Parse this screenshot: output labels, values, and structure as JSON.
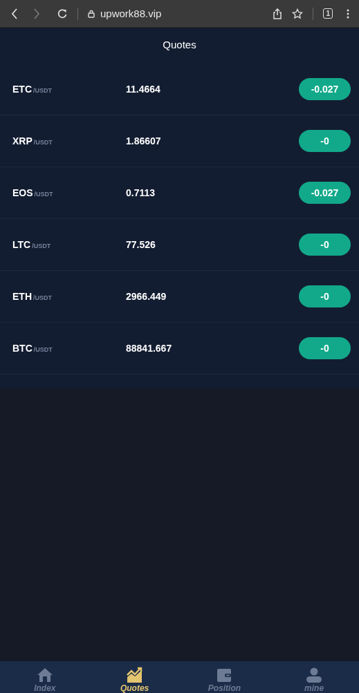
{
  "browser": {
    "url": "upwork88.vip",
    "tab_count": "1"
  },
  "header": {
    "title": "Quotes"
  },
  "quotes": [
    {
      "symbol": "ETC",
      "pair": "/USDT",
      "price": "11.4664",
      "change": "-0.027"
    },
    {
      "symbol": "XRP",
      "pair": "/USDT",
      "price": "1.86607",
      "change": "-0"
    },
    {
      "symbol": "EOS",
      "pair": "/USDT",
      "price": "0.7113",
      "change": "-0.027"
    },
    {
      "symbol": "LTC",
      "pair": "/USDT",
      "price": "77.526",
      "change": "-0"
    },
    {
      "symbol": "ETH",
      "pair": "/USDT",
      "price": "2966.449",
      "change": "-0"
    },
    {
      "symbol": "BTC",
      "pair": "/USDT",
      "price": "88841.667",
      "change": "-0"
    }
  ],
  "nav": [
    {
      "label": "Index",
      "kind": "home",
      "selected": false
    },
    {
      "label": "Quotes",
      "kind": "chart",
      "selected": true
    },
    {
      "label": "Position",
      "kind": "wallet",
      "selected": false
    },
    {
      "label": "mine",
      "kind": "person",
      "selected": false
    }
  ]
}
